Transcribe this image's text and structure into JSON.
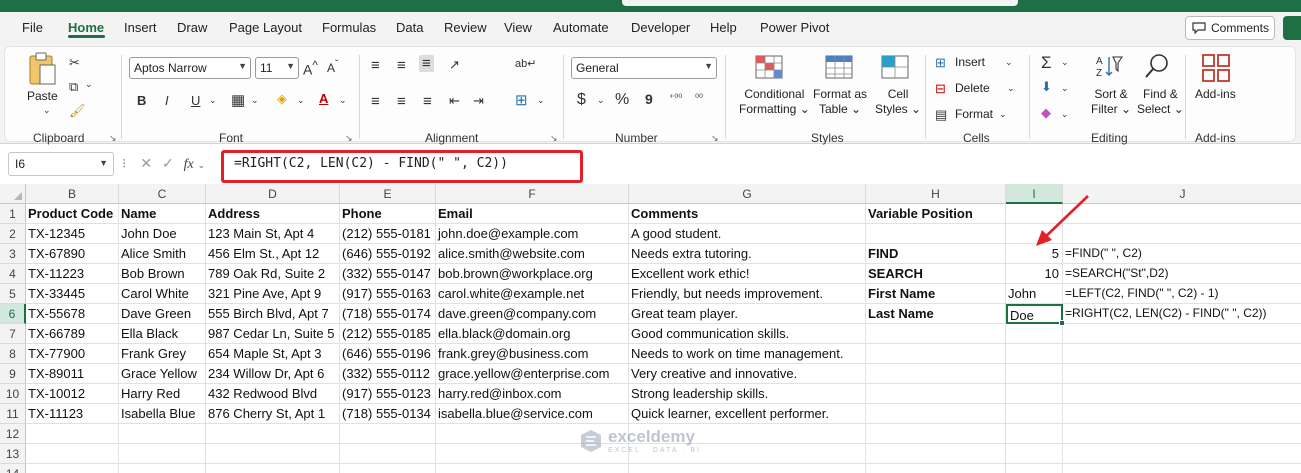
{
  "menu": {
    "tabs": [
      "File",
      "Home",
      "Insert",
      "Draw",
      "Page Layout",
      "Formulas",
      "Data",
      "Review",
      "View",
      "Automate",
      "Developer",
      "Help",
      "Power Pivot"
    ],
    "active_tab": "Home",
    "comments_label": "Comments"
  },
  "ribbon": {
    "clipboard": {
      "label": "Clipboard",
      "paste_label": "Paste"
    },
    "font": {
      "label": "Font",
      "font_name": "Aptos Narrow",
      "font_size": "11",
      "bold": "B",
      "italic": "I",
      "underline": "U",
      "font_color_letter": "A"
    },
    "alignment": {
      "label": "Alignment"
    },
    "number": {
      "label": "Number",
      "format": "General",
      "currency": "$",
      "percent": "%",
      "comma": "9"
    },
    "styles": {
      "label": "Styles",
      "conditional": [
        "Conditional",
        "Formatting"
      ],
      "format_table": [
        "Format as",
        "Table"
      ],
      "cell_styles": [
        "Cell",
        "Styles"
      ]
    },
    "cells": {
      "label": "Cells",
      "insert": "Insert",
      "delete": "Delete",
      "format": "Format"
    },
    "editing": {
      "label": "Editing",
      "sort_filter": [
        "Sort &",
        "Filter"
      ],
      "find_select": [
        "Find &",
        "Select"
      ]
    },
    "addins": {
      "label": "Add-ins",
      "addins_btn": "Add-ins"
    }
  },
  "formula_bar": {
    "name_box": "I6",
    "fx": "fx",
    "formula": "=RIGHT(C2, LEN(C2) - FIND(\" \", C2))"
  },
  "columns": [
    "B",
    "C",
    "D",
    "E",
    "F",
    "G",
    "H",
    "I",
    "J"
  ],
  "selected_column": "I",
  "selected_row": 6,
  "rows": [
    "1",
    "2",
    "3",
    "4",
    "5",
    "6",
    "7",
    "8",
    "9",
    "10",
    "11",
    "12",
    "13",
    "14"
  ],
  "headers": {
    "B": "Product Code",
    "C": "Name",
    "D": "Address",
    "E": "Phone",
    "F": "Email",
    "G": "Comments",
    "H": "Variable Position"
  },
  "table": [
    [
      "TX-12345",
      "John Doe",
      "123 Main St, Apt 4",
      "(212) 555-0181",
      "john.doe@example.com",
      "A good student."
    ],
    [
      "TX-67890",
      "Alice Smith",
      "456 Elm St., Apt 12",
      "(646) 555-0192",
      "alice.smith@website.com",
      "Needs extra tutoring."
    ],
    [
      "TX-11223",
      "Bob Brown",
      "789 Oak Rd, Suite 2",
      "(332) 555-0147",
      "bob.brown@workplace.org",
      "Excellent work ethic!"
    ],
    [
      "TX-33445",
      "Carol White",
      "321 Pine Ave, Apt 9",
      "(917) 555-0163",
      "carol.white@example.net",
      "Friendly, but needs improvement."
    ],
    [
      "TX-55678",
      "Dave Green",
      "555 Birch Blvd, Apt 7",
      "(718) 555-0174",
      "dave.green@company.com",
      "Great team player."
    ],
    [
      "TX-66789",
      "Ella Black",
      "987 Cedar Ln, Suite 5",
      "(212) 555-0185",
      "ella.black@domain.org",
      "Good communication skills."
    ],
    [
      "TX-77900",
      "Frank Grey",
      "654 Maple St, Apt 3",
      "(646) 555-0196",
      "frank.grey@business.com",
      "Needs to work on time management."
    ],
    [
      "TX-89011",
      "Grace Yellow",
      "234 Willow Dr, Apt 6",
      "(332) 555-0112",
      "grace.yellow@enterprise.com",
      "Very creative and innovative."
    ],
    [
      "TX-10012",
      "Harry Red",
      "432 Redwood Blvd",
      "(917) 555-0123",
      "harry.red@inbox.com",
      "Strong leadership skills."
    ],
    [
      "TX-11123",
      "Isabella Blue",
      "876 Cherry St, Apt 1",
      "(718) 555-0134",
      "isabella.blue@service.com",
      "Quick learner, excellent performer."
    ]
  ],
  "variables": [
    {
      "label": "FIND",
      "value": "5",
      "formula": "=FIND(\" \", C2)"
    },
    {
      "label": "SEARCH",
      "value": "10",
      "formula": "=SEARCH(\"St\",D2)"
    },
    {
      "label": "First Name",
      "value": "John",
      "formula": "=LEFT(C2, FIND(\" \", C2) - 1)"
    },
    {
      "label": "Last Name",
      "value": "Doe",
      "formula": "=RIGHT(C2, LEN(C2) - FIND(\" \", C2))"
    }
  ],
  "watermark": {
    "name": "exceldemy",
    "sub": "EXCEL · DATA · BI"
  },
  "colors": {
    "accent": "#1e6f43",
    "annotation": "#e3202a"
  }
}
